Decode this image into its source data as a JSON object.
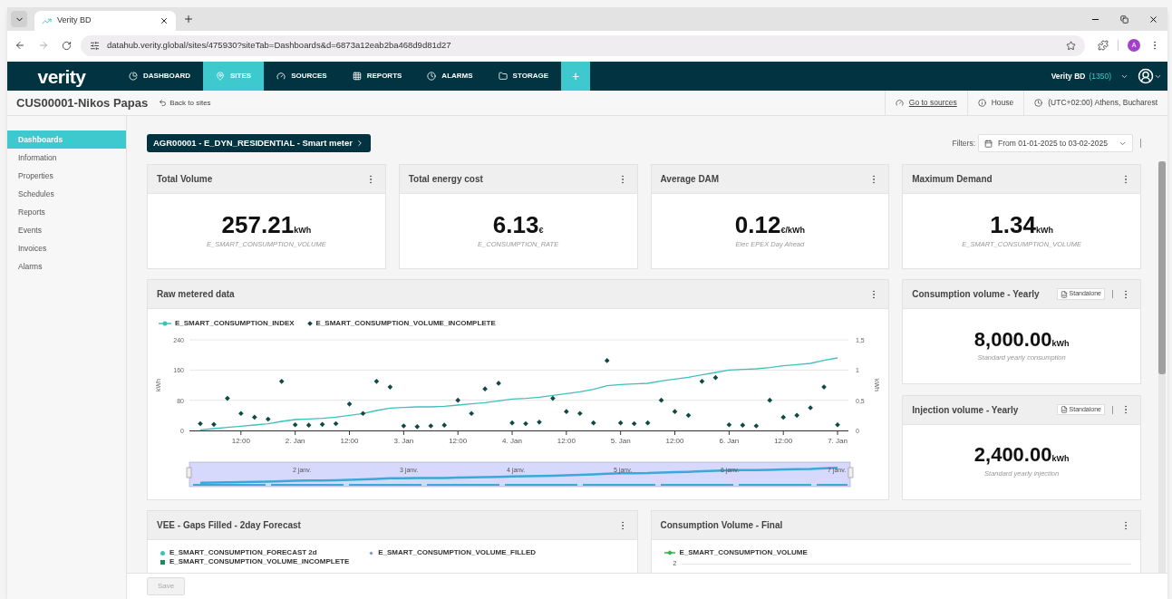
{
  "browser": {
    "tab_title": "Verity BD",
    "url": "datahub.verity.global/sites/475930?siteTab=Dashboards&d=6873a12eab2ba468d9d81d27",
    "profile_initial": "A"
  },
  "nav": {
    "logo": "verity",
    "items": [
      {
        "label": "DASHBOARD",
        "selected": false
      },
      {
        "label": "SITES",
        "selected": true
      },
      {
        "label": "SOURCES",
        "selected": false
      },
      {
        "label": "REPORTS",
        "selected": false
      },
      {
        "label": "ALARMS",
        "selected": false
      },
      {
        "label": "STORAGE",
        "selected": false
      }
    ],
    "add_label": "+",
    "account_name": "Verity BD",
    "account_count": "(1350)"
  },
  "header": {
    "title": "CUS00001-Nikos Papas",
    "back_link": "Back to sites",
    "links": [
      {
        "kind": "sources",
        "label": "Go to sources"
      },
      {
        "kind": "info",
        "label": "House"
      },
      {
        "kind": "clock",
        "label": "(UTC+02:00) Athens, Bucharest"
      }
    ]
  },
  "sidebar": {
    "items": [
      {
        "label": "Dashboards",
        "selected": true
      },
      {
        "label": "Information",
        "selected": false
      },
      {
        "label": "Properties",
        "selected": false
      },
      {
        "label": "Schedules",
        "selected": false
      },
      {
        "label": "Reports",
        "selected": false
      },
      {
        "label": "Events",
        "selected": false
      },
      {
        "label": "Invoices",
        "selected": false
      },
      {
        "label": "Alarms",
        "selected": false
      }
    ]
  },
  "meter_chip": "AGR00001 - E_DYN_RESIDENTIAL - Smart meter",
  "filters": {
    "label": "Filters:",
    "date_range": "From 01-01-2025 to 03-02-2025"
  },
  "kpis": [
    {
      "title": "Total Volume",
      "value": "257.21",
      "unit": "kWh",
      "caption": "E_SMART_CONSUMPTION_VOLUME"
    },
    {
      "title": "Total energy cost",
      "value": "6.13",
      "unit": "€",
      "caption": "E_CONSUMPTION_RATE"
    },
    {
      "title": "Average DAM",
      "value": "0.12",
      "unit": "€/kWh",
      "caption": "Elec EPEX Day Ahead"
    },
    {
      "title": "Maximum Demand",
      "value": "1.34",
      "unit": "kWh",
      "caption": "E_SMART_CONSUMPTION_VOLUME"
    }
  ],
  "raw_chart": {
    "title": "Raw metered data",
    "chart_data": {
      "type": "scatter",
      "ylabel": "kWh",
      "xlim": [
        "2025-01-01T00:36",
        "2025-01-07T02:24"
      ],
      "ylim": [
        0,
        240
      ],
      "yticks": [
        0,
        80,
        160,
        240
      ],
      "y2label": "kWh",
      "y2lim": [
        0,
        1.5
      ],
      "y2ticks": [
        {
          "value": 0,
          "label": "0"
        },
        {
          "value": 0.5,
          "label": "0,5"
        },
        {
          "value": 1,
          "label": "1"
        },
        {
          "value": 1.5,
          "label": "1,5"
        }
      ],
      "xticks": [
        {
          "value": "2025-01-01T12:00",
          "label": "12:00"
        },
        {
          "value": "2025-01-02T00:00",
          "label": "2. Jan"
        },
        {
          "value": "2025-01-02T12:00",
          "label": "12:00"
        },
        {
          "value": "2025-01-03T00:00",
          "label": "3. Jan"
        },
        {
          "value": "2025-01-03T12:00",
          "label": "12:00"
        },
        {
          "value": "2025-01-04T00:00",
          "label": "4. Jan"
        },
        {
          "value": "2025-01-04T12:00",
          "label": "12:00"
        },
        {
          "value": "2025-01-05T00:00",
          "label": "5. Jan"
        },
        {
          "value": "2025-01-05T12:00",
          "label": "12:00"
        },
        {
          "value": "2025-01-06T00:00",
          "label": "6. Jan"
        },
        {
          "value": "2025-01-06T12:00",
          "label": "12:00"
        },
        {
          "value": "2025-01-07T00:00",
          "label": "7. Jan"
        }
      ],
      "x": [
        "2025-01-01T03:00",
        "2025-01-01T06:00",
        "2025-01-01T09:00",
        "2025-01-01T12:00",
        "2025-01-01T15:00",
        "2025-01-01T18:00",
        "2025-01-01T21:00",
        "2025-01-02T00:00",
        "2025-01-02T03:00",
        "2025-01-02T06:00",
        "2025-01-02T09:00",
        "2025-01-02T12:00",
        "2025-01-02T15:00",
        "2025-01-02T18:00",
        "2025-01-02T21:00",
        "2025-01-03T00:00",
        "2025-01-03T03:00",
        "2025-01-03T06:00",
        "2025-01-03T09:00",
        "2025-01-03T12:00",
        "2025-01-03T15:00",
        "2025-01-03T18:00",
        "2025-01-03T21:00",
        "2025-01-04T00:00",
        "2025-01-04T03:00",
        "2025-01-04T06:00",
        "2025-01-04T09:00",
        "2025-01-04T12:00",
        "2025-01-04T15:00",
        "2025-01-04T18:00",
        "2025-01-04T21:00",
        "2025-01-05T00:00",
        "2025-01-05T03:00",
        "2025-01-05T06:00",
        "2025-01-05T09:00",
        "2025-01-05T12:00",
        "2025-01-05T15:00",
        "2025-01-05T18:00",
        "2025-01-05T21:00",
        "2025-01-06T00:00",
        "2025-01-06T03:00",
        "2025-01-06T06:00",
        "2025-01-06T09:00",
        "2025-01-06T12:00",
        "2025-01-06T15:00",
        "2025-01-06T18:00",
        "2025-01-06T21:00",
        "2025-01-07T00:00"
      ],
      "series": [
        {
          "name": "E_SMART_CONSUMPTION_INDEX",
          "color": "#3ec1bd",
          "type": "line",
          "axis": "y2",
          "values": [
            0.01,
            0.03,
            0.05,
            0.07,
            0.09,
            0.11,
            0.15,
            0.18,
            0.19,
            0.2,
            0.22,
            0.25,
            0.28,
            0.33,
            0.37,
            0.38,
            0.39,
            0.39,
            0.4,
            0.42,
            0.44,
            0.46,
            0.49,
            0.52,
            0.53,
            0.55,
            0.58,
            0.61,
            0.64,
            0.68,
            0.74,
            0.76,
            0.77,
            0.78,
            0.82,
            0.85,
            0.88,
            0.92,
            0.96,
            1,
            1.01,
            1.02,
            1.04,
            1.07,
            1.09,
            1.11,
            1.16,
            1.2
          ]
        },
        {
          "name": "E_SMART_CONSUMPTION_VOLUME_INCOMPLETE",
          "color": "#0f4a45",
          "values": [
            18,
            16,
            85,
            45,
            35,
            30,
            130,
            15,
            14,
            16,
            18,
            70,
            45,
            130,
            115,
            12,
            10,
            12,
            14,
            80,
            45,
            110,
            125,
            20,
            18,
            22,
            85,
            50,
            45,
            20,
            185,
            20,
            18,
            20,
            80,
            50,
            40,
            130,
            140,
            15,
            14,
            12,
            80,
            35,
            40,
            60,
            115,
            15
          ]
        }
      ]
    },
    "navigator_labels": [
      "2 janv.",
      "3 janv.",
      "4 janv.",
      "5 janv.",
      "6 janv.",
      "7 janv."
    ]
  },
  "yearly": [
    {
      "title": "Consumption volume - Yearly",
      "badge": "Standalone",
      "value": "8,000.00",
      "unit": "kWh",
      "caption": "Standard yearly consumption"
    },
    {
      "title": "Injection volume - Yearly",
      "badge": "Standalone",
      "value": "2,400.00",
      "unit": "kWh",
      "caption": "Standard yearly injection"
    }
  ],
  "bottom_panels": [
    {
      "title": "VEE - Gaps Filled - 2day Forecast",
      "legend": [
        {
          "label": "E_SMART_CONSUMPTION_FORECAST 2d",
          "kind": "dot",
          "color": "#3ec1bd"
        },
        {
          "label": "E_SMART_CONSUMPTION_VOLUME_INCOMPLETE",
          "kind": "square",
          "color": "#1e8a5a"
        },
        {
          "label": "E_SMART_CONSUMPTION_VOLUME_FILLED",
          "kind": "diamond",
          "color": "#7b8fe0"
        }
      ]
    },
    {
      "title": "Consumption Volume - Final",
      "legend": [
        {
          "label": "E_SMART_CONSUMPTION_VOLUME",
          "kind": "line",
          "color": "#2fb34a"
        }
      ],
      "axis_label": "2"
    }
  ],
  "save_button": {
    "label": "Save",
    "disabled": true
  }
}
